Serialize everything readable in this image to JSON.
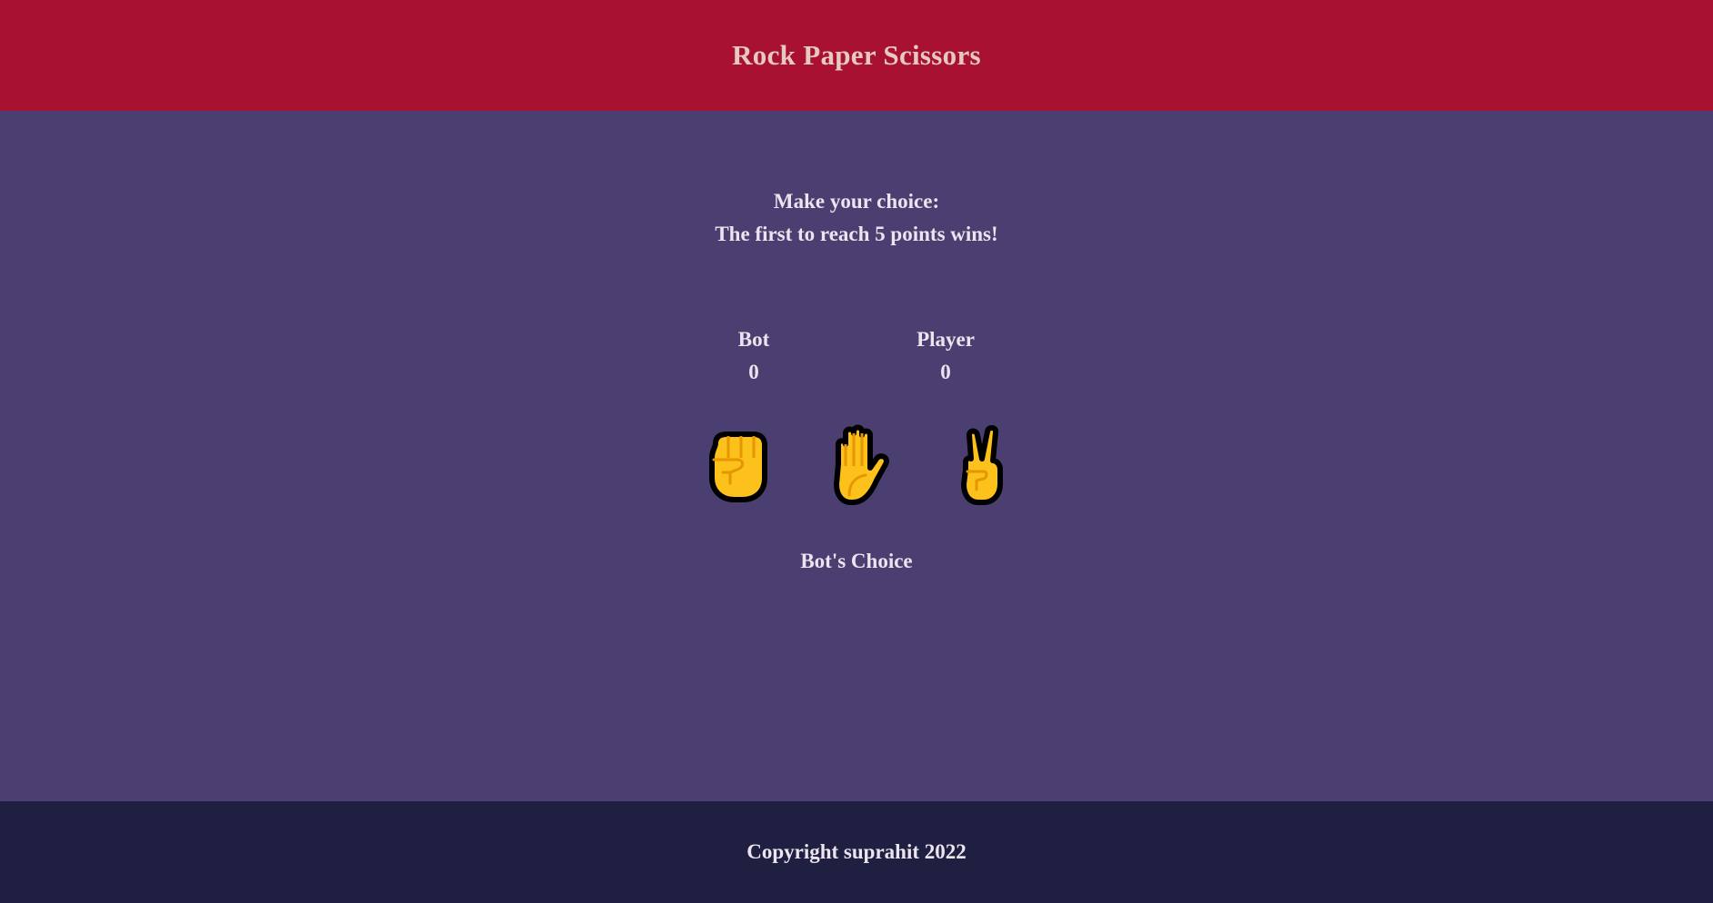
{
  "header": {
    "title": "Rock Paper Scissors"
  },
  "main": {
    "instruction_line1": "Make your choice:",
    "instruction_line2": "The first to reach 5 points wins!",
    "scoreboard": {
      "bot_label": "Bot",
      "bot_score": "0",
      "player_label": "Player",
      "player_score": "0"
    },
    "choices": [
      {
        "name": "rock",
        "icon": "raised-fist-icon"
      },
      {
        "name": "paper",
        "icon": "raised-hand-icon"
      },
      {
        "name": "scissors",
        "icon": "victory-hand-icon"
      }
    ],
    "bot_choice_label": "Bot's Choice"
  },
  "footer": {
    "copyright": "Copyright suprahit 2022"
  },
  "colors": {
    "header_bg": "#a91132",
    "main_bg": "#4a3f70",
    "footer_bg": "#1f1f42",
    "emoji_fill": "#fcc21b"
  }
}
